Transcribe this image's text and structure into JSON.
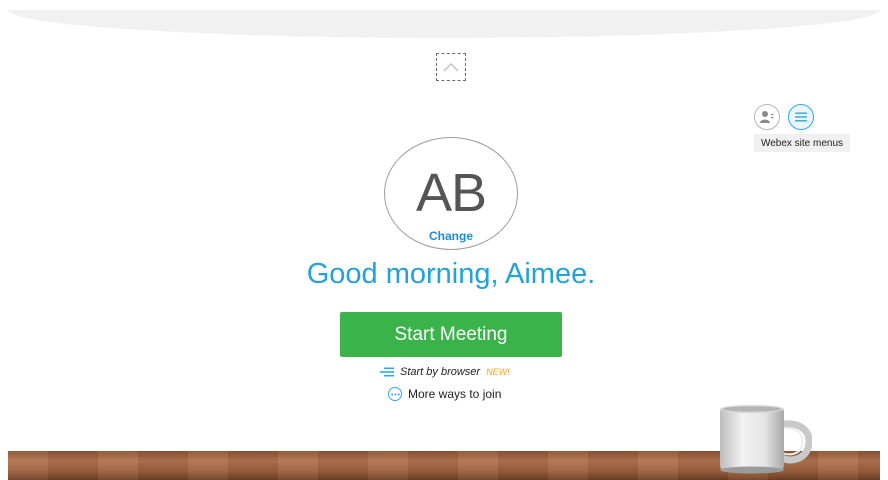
{
  "header": {
    "collapse_icon": "chevron-up-icon"
  },
  "site_menus": {
    "profile_icon": "person-icon",
    "menu_icon": "hamburger-icon",
    "tooltip": "Webex site menus",
    "accent_color": "#2ea8de"
  },
  "avatar": {
    "initials": "AB",
    "change_label": "Change"
  },
  "greeting": "Good morning, Aimee.",
  "start_meeting": {
    "label": "Start Meeting",
    "color": "#3ab34a"
  },
  "browser_option": {
    "label": "Start by browser",
    "badge": "NEW!",
    "icon": "browser-lines-icon"
  },
  "more_ways": {
    "label": "More ways to join",
    "icon": "ellipsis-circle-icon"
  },
  "decor": {
    "mug_icon": "coffee-mug-icon",
    "table_color": "#9a5f3d"
  }
}
